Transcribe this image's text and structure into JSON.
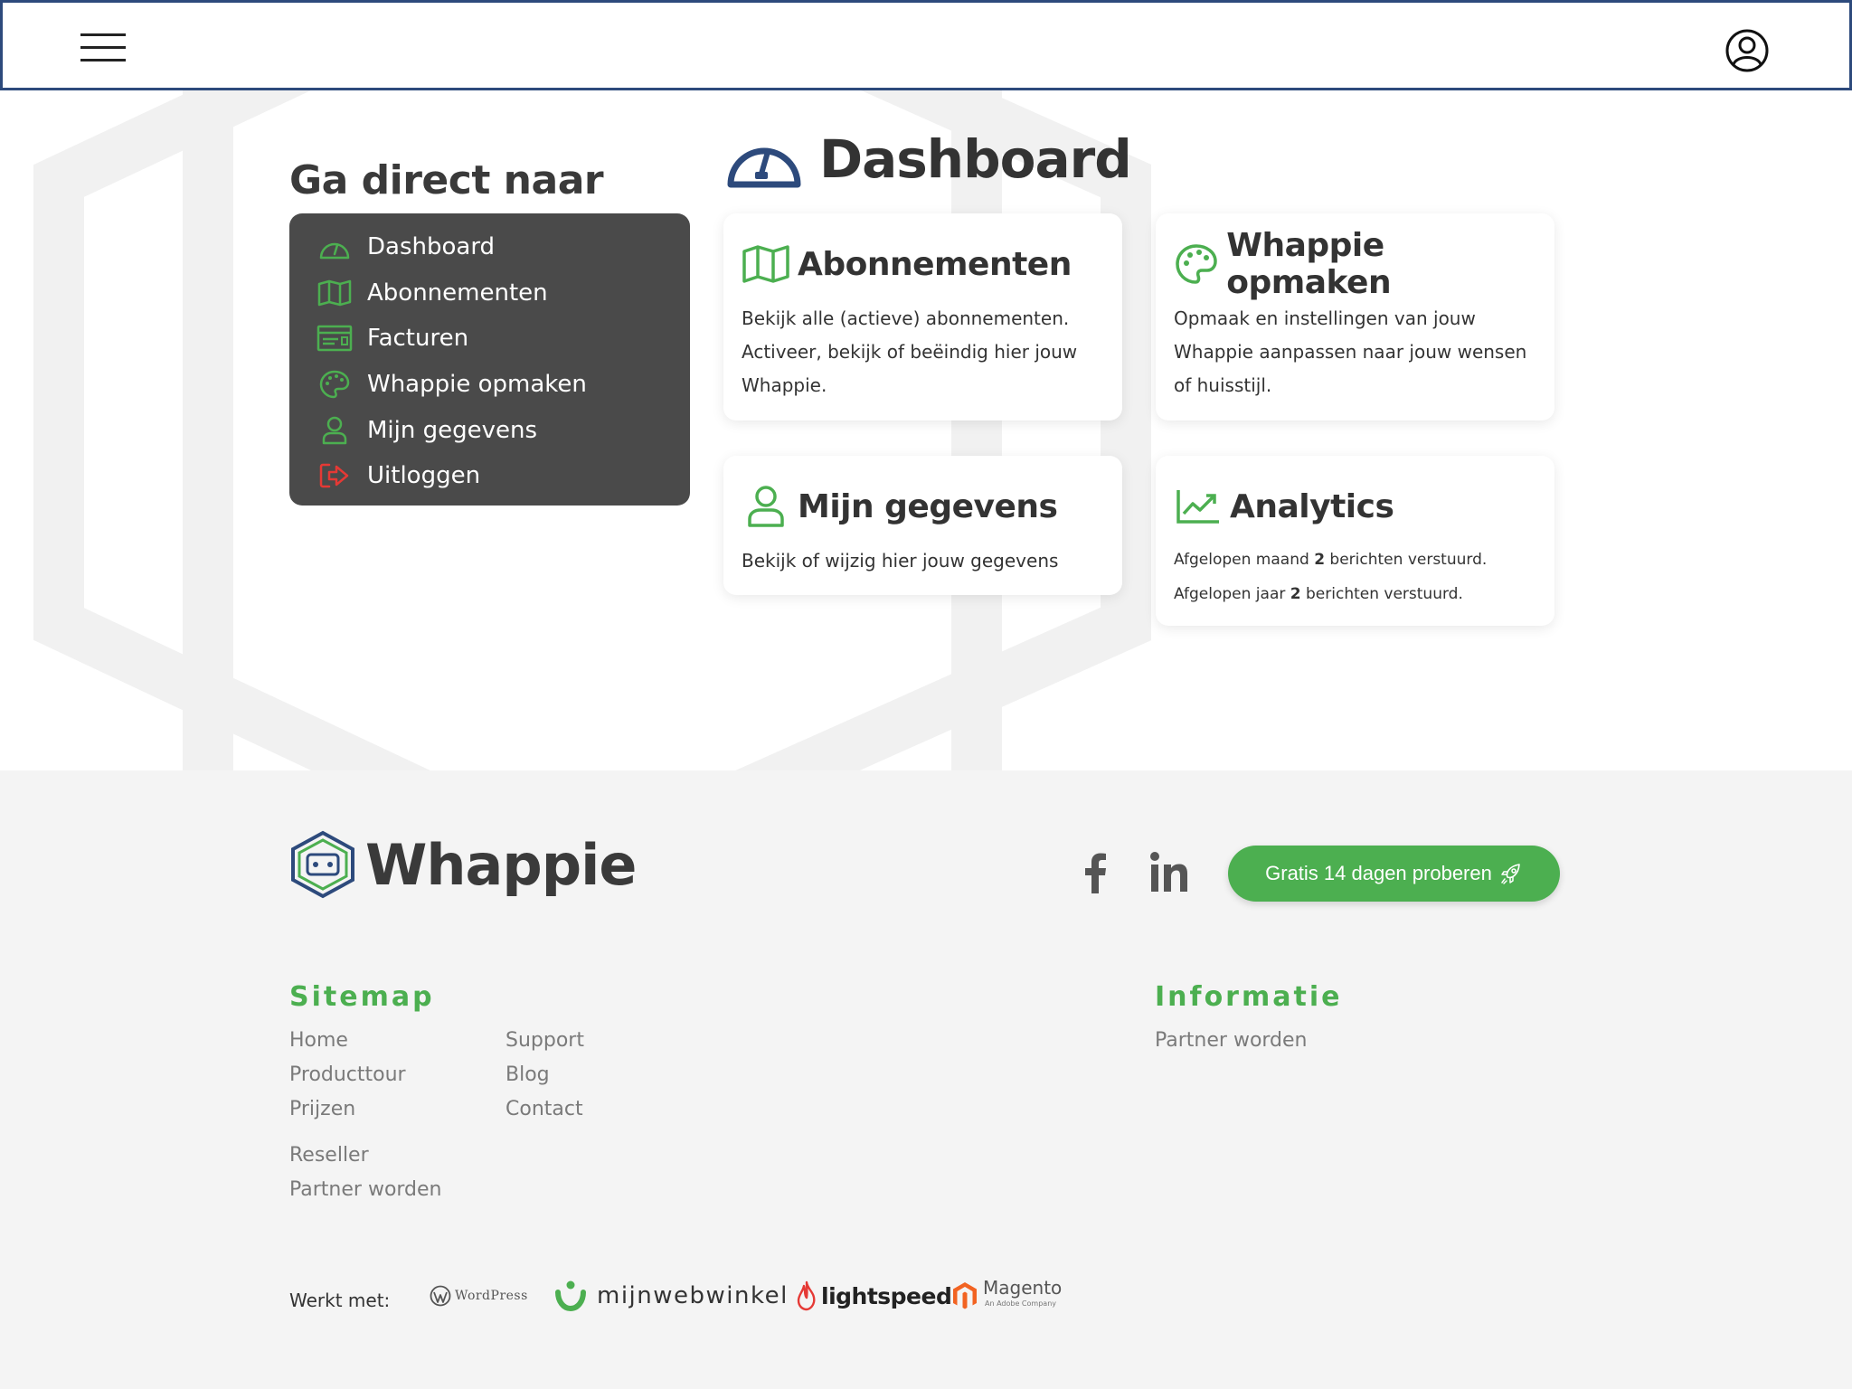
{
  "colors": {
    "accent_green": "#4caf50",
    "brand_blue": "#2d4a7c",
    "logout_red": "#e53935",
    "menu_bg": "#4a4a4a",
    "footer_bg": "#f4f4f4"
  },
  "sidebar": {
    "title": "Ga direct naar",
    "items": [
      {
        "label": "Dashboard",
        "icon": "gauge-icon"
      },
      {
        "label": "Abonnementen",
        "icon": "map-icon"
      },
      {
        "label": "Facturen",
        "icon": "invoice-icon"
      },
      {
        "label": "Whappie opmaken",
        "icon": "palette-icon"
      },
      {
        "label": "Mijn gegevens",
        "icon": "user-icon"
      },
      {
        "label": "Uitloggen",
        "icon": "logout-icon"
      }
    ]
  },
  "dashboard": {
    "title": "Dashboard",
    "cards": {
      "subscriptions": {
        "title": "Abonnementen",
        "text": "Bekijk alle (actieve) abonnementen. Activeer, bekijk of beëindig hier jouw Whappie."
      },
      "styling": {
        "title": "Whappie opmaken",
        "text": "Opmaak en instellingen van jouw Whappie aanpassen naar jouw wensen of huisstijl."
      },
      "details": {
        "title": "Mijn gegevens",
        "text": "Bekijk of wijzig hier jouw gegevens"
      },
      "analytics": {
        "title": "Analytics",
        "month_prefix": "Afgelopen maand ",
        "month_count": "2",
        "month_suffix": " berichten verstuurd.",
        "year_prefix": "Afgelopen jaar ",
        "year_count": "2",
        "year_suffix": " berichten verstuurd."
      }
    }
  },
  "footer": {
    "logo_text": "Whappie",
    "social": {
      "facebook": "facebook-icon",
      "linkedin": "linkedin-icon"
    },
    "cta_label": "Gratis 14 dagen proberen",
    "sitemap": {
      "heading": "Sitemap",
      "col1": [
        "Home",
        "Producttour",
        "Prijzen"
      ],
      "col2": [
        "Support",
        "Blog",
        "Contact"
      ],
      "col3": [
        "Reseller",
        "Partner worden"
      ]
    },
    "info": {
      "heading": "Informatie",
      "links": [
        "Partner worden"
      ]
    },
    "works_with": {
      "label": "Werkt met:",
      "wordpress": "WordPress",
      "mijnwebwinkel": "mijnwebwinkel",
      "lightspeed": "lightspeed",
      "magento": "Magento",
      "magento_sub": "An Adobe Company"
    }
  }
}
